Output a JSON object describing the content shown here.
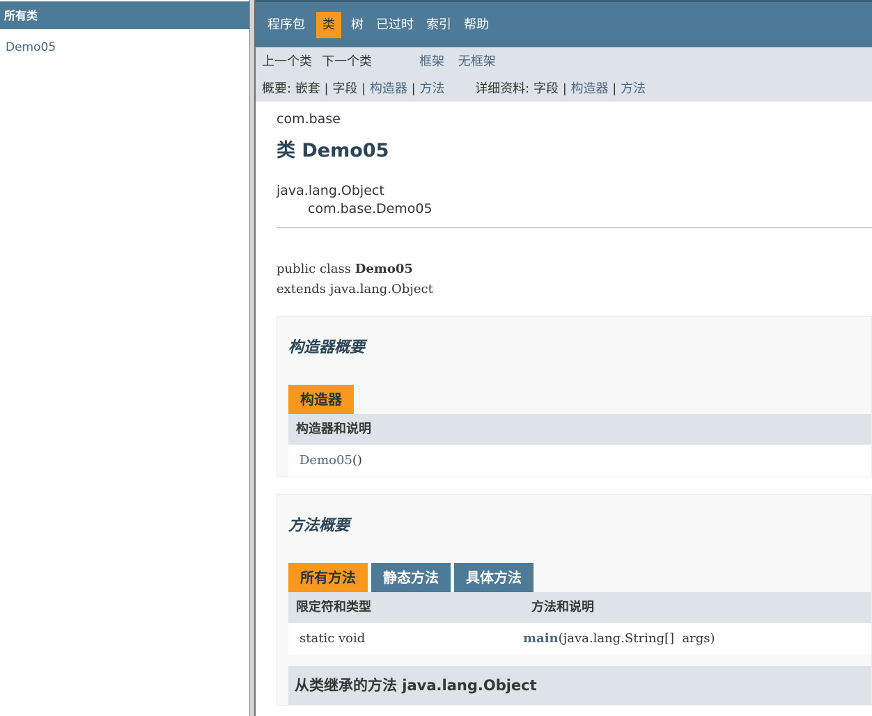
{
  "left": {
    "header": "所有类",
    "classes": [
      "Demo05"
    ]
  },
  "topnav": {
    "items": [
      "程序包",
      "类",
      "树",
      "已过时",
      "索引",
      "帮助"
    ],
    "active": "类"
  },
  "subnav": {
    "prev_class": "上一个类",
    "next_class": "下一个类",
    "frames": "框架",
    "no_frames": "无框架",
    "summary_label": "概要:",
    "summary_nested": "嵌套",
    "summary_field": "字段",
    "summary_constr": "构造器",
    "summary_method": "方法",
    "detail_label": "详细资料:",
    "detail_field": "字段",
    "detail_constr": "构造器",
    "detail_method": "方法",
    "sep": "|"
  },
  "header": {
    "package": "com.base",
    "title": "类 Demo05"
  },
  "inheritance": {
    "parent": "java.lang.Object",
    "child": "com.base.Demo05"
  },
  "signature": {
    "line1_prefix": "public class ",
    "line1_name": "Demo05",
    "line2": "extends java.lang.Object"
  },
  "constructor_summary": {
    "heading": "构造器概要",
    "tab": "构造器",
    "col": "构造器和说明",
    "row_name": "Demo05",
    "row_args": "()"
  },
  "method_summary": {
    "heading": "方法概要",
    "tabs": [
      "所有方法",
      "静态方法",
      "具体方法"
    ],
    "col1": "限定符和类型",
    "col2": "方法和说明",
    "row_type": "static void",
    "row_name": "main",
    "row_args": "(java.lang.String[]  args)"
  },
  "inherited": {
    "heading": "从类继承的方法 java.lang.Object"
  }
}
